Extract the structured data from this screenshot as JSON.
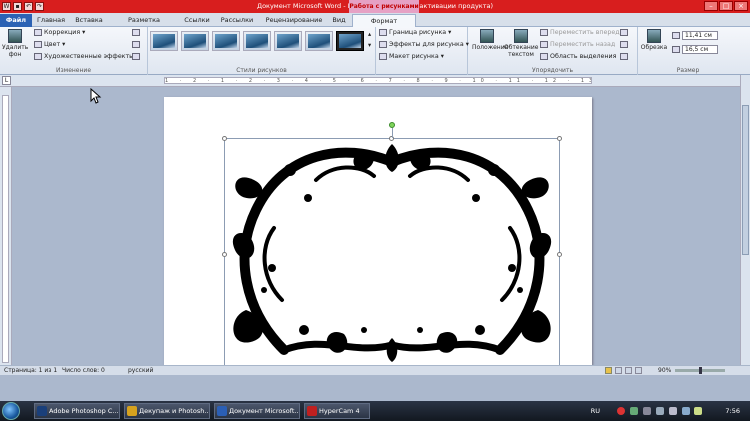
{
  "window": {
    "title": "Документ Microsoft Word  -  Microsoft Word (Сбой активации продукта)",
    "contextual_group": "Работа с рисунками",
    "controls": [
      "–",
      "□",
      "×"
    ]
  },
  "tabs": [
    "Файл",
    "Главная",
    "Вставка",
    "Разметка страницы",
    "Ссылки",
    "Рассылки",
    "Рецензирование",
    "Вид",
    "Формат"
  ],
  "active_tab": "Формат",
  "ribbon": {
    "adjust": {
      "remove_bg": "Удалить фон",
      "correction": "Коррекция",
      "color": "Цвет",
      "artistic": "Художественные эффекты",
      "label": "Изменение"
    },
    "styles": {
      "label": "Стили рисунков",
      "thumb_count": 7
    },
    "picture_tools": {
      "border": "Граница рисунка",
      "effects": "Эффекты для рисунка",
      "layout": "Макет рисунка"
    },
    "arrange": {
      "position": "Положение",
      "wrap": "Обтекание текстом",
      "forward": "Переместить вперед",
      "backward": "Переместить назад",
      "selection_pane": "Область выделения",
      "label": "Упорядочить"
    },
    "size": {
      "crop": "Обрезка",
      "height": "11,41 см",
      "width": "16,5 см",
      "label": "Размер"
    }
  },
  "ruler_marks": "1 · 2 · 1 · 2 · 3 · 4 · 5 · 6 · 7 · 8 · 9 · 10 · 11 · 12 · 13 · 14 · 15 · 16 · 17",
  "status": {
    "page": "Страница: 1 из 1",
    "words": "Число слов: 0",
    "language": "русский",
    "zoom": "90%"
  },
  "taskbar": {
    "items": [
      {
        "label": "Adobe Photoshop C...",
        "color": "#1a3f7a"
      },
      {
        "label": "Декупаж и Photosh...",
        "color": "#d6a21e"
      },
      {
        "label": "Документ Microsoft...",
        "color": "#2b5fb5"
      },
      {
        "label": "HyperCam 4",
        "color": "#c02020"
      }
    ],
    "lang": "RU",
    "time": "7:56"
  }
}
